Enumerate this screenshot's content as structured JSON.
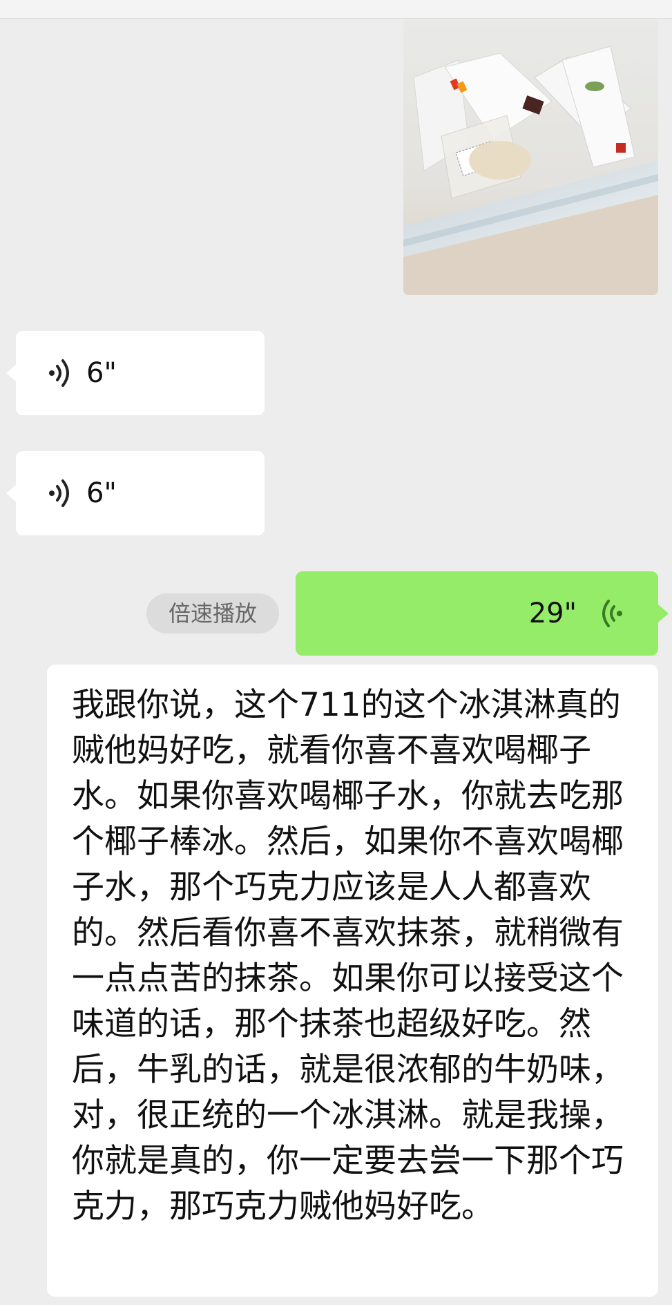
{
  "messages": [
    {
      "type": "image",
      "side": "right"
    },
    {
      "type": "voice",
      "side": "left",
      "duration": "6\""
    },
    {
      "type": "voice",
      "side": "left",
      "duration": "6\""
    },
    {
      "type": "voice",
      "side": "right",
      "duration": "29\""
    }
  ],
  "speed_button": "倍速播放",
  "transcript": {
    "text": "我跟你说，这个711的这个冰淇淋真的贼他妈好吃，就看你喜不喜欢喝椰子水。如果你喜欢喝椰子水，你就去吃那个椰子棒冰。然后，如果你不喜欢喝椰子水，那个巧克力应该是人人都喜欢的。然后看你喜不喜欢抹茶，就稍微有一点点苦的抹茶。如果你可以接受这个味道的话，那个抹茶也超级好吃。然后，牛乳的话，就是很浓郁的牛奶味，对，很正统的一个冰淇淋。就是我操，你就是真的，你一定要去尝一下那个巧克力，那巧克力贼他妈好吃。"
  },
  "colors": {
    "background": "#ededed",
    "incoming_bubble": "#ffffff",
    "outgoing_bubble": "#95ec69",
    "outgoing_wave": "#3a7a22"
  },
  "icons": {
    "incoming_voice": "sound-wave-icon",
    "outgoing_voice": "sound-wave-reversed-icon"
  }
}
